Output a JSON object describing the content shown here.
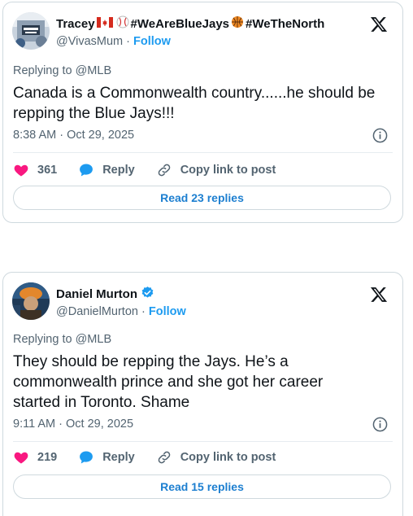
{
  "tweets": [
    {
      "display_name": "Tracey",
      "name_tags": [
        "#WeAreBlueJays",
        "#WeTheNorth"
      ],
      "handle": "@VivasMum",
      "separator": "·",
      "follow_label": "Follow",
      "replying_prefix": "Replying to",
      "replying_to": "@MLB",
      "text": "Canada is a Commonwealth country......he should be repping the Blue Jays!!!",
      "timestamp": "8:38 AM · Oct 29, 2025",
      "likes": "361",
      "reply_label": "Reply",
      "copy_label": "Copy link to post",
      "read_replies_label": "Read 23 replies",
      "verified": false
    },
    {
      "display_name": "Daniel Murton",
      "handle": "@DanielMurton",
      "separator": "·",
      "follow_label": "Follow",
      "replying_prefix": "Replying to",
      "replying_to": "@MLB",
      "text": "They should be repping the Jays. He’s a commonwealth prince and she got her career started in Toronto.  Shame",
      "timestamp": "9:11 AM · Oct 29, 2025",
      "likes": "219",
      "reply_label": "Reply",
      "copy_label": "Copy link to post",
      "read_replies_label": "Read 15 replies",
      "verified": true
    }
  ],
  "colors": {
    "accent": "#1d9bf0",
    "like": "#f91880",
    "muted": "#536471",
    "border": "#cfd9de"
  },
  "icons": [
    "x-logo-icon",
    "heart-icon",
    "reply-bubble-icon",
    "link-icon",
    "info-icon",
    "verified-badge-icon",
    "canada-flag-icon",
    "baseball-icon",
    "basketball-icon"
  ]
}
